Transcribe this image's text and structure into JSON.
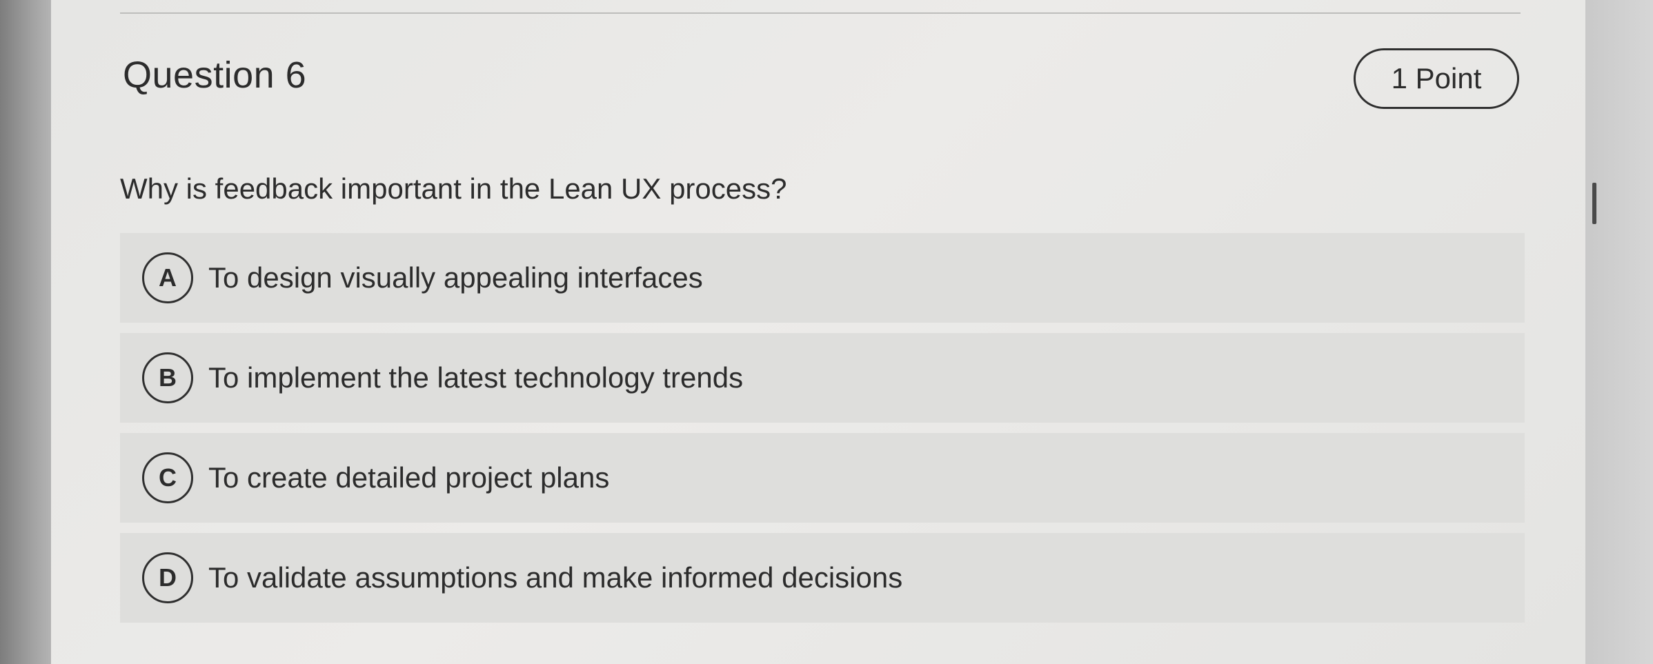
{
  "question": {
    "title": "Question 6",
    "points": "1 Point",
    "prompt": "Why is feedback important in the Lean UX process?"
  },
  "options": [
    {
      "letter": "A",
      "text": "To design visually appealing interfaces"
    },
    {
      "letter": "B",
      "text": "To implement the latest technology trends"
    },
    {
      "letter": "C",
      "text": "To create detailed project plans"
    },
    {
      "letter": "D",
      "text": "To validate assumptions and make informed decisions"
    }
  ],
  "colors": {
    "background": "#e8e8e6",
    "option_bg": "#dededc",
    "text": "#2c2c2c"
  }
}
